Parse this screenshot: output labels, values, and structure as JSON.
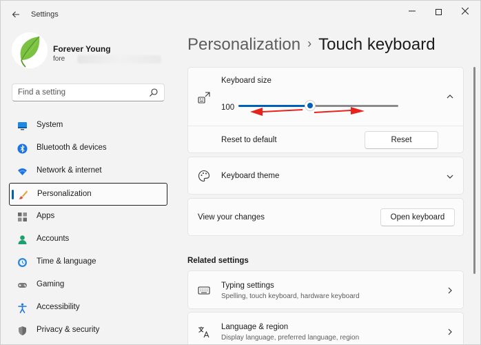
{
  "window": {
    "title": "Settings"
  },
  "profile": {
    "name": "Forever Young",
    "email_visible": "fore"
  },
  "search": {
    "placeholder": "Find a setting"
  },
  "nav": {
    "items": [
      {
        "label": "System",
        "icon": "system-icon",
        "color": "#0067c0"
      },
      {
        "label": "Bluetooth & devices",
        "icon": "bluetooth-icon",
        "color": "#0067c0"
      },
      {
        "label": "Network & internet",
        "icon": "network-icon",
        "color": "#0067c0"
      },
      {
        "label": "Personalization",
        "icon": "brush-icon",
        "color": "#e07a2c",
        "active": true
      },
      {
        "label": "Apps",
        "icon": "apps-icon",
        "color": "#555555"
      },
      {
        "label": "Accounts",
        "icon": "accounts-icon",
        "color": "#1f9e6e"
      },
      {
        "label": "Time & language",
        "icon": "globe-clock-icon",
        "color": "#0067c0"
      },
      {
        "label": "Gaming",
        "icon": "gamepad-icon",
        "color": "#6b6b6b"
      },
      {
        "label": "Accessibility",
        "icon": "accessibility-icon",
        "color": "#0067c0"
      },
      {
        "label": "Privacy & security",
        "icon": "shield-icon",
        "color": "#6b6b6b"
      }
    ]
  },
  "breadcrumb": {
    "parent": "Personalization",
    "separator": "›",
    "current": "Touch keyboard"
  },
  "keyboard_size": {
    "title": "Keyboard size",
    "value": "100",
    "slider_fraction": 0.45,
    "reset_label": "Reset to default",
    "reset_button": "Reset"
  },
  "keyboard_theme": {
    "title": "Keyboard theme"
  },
  "view_changes": {
    "label": "View your changes",
    "button": "Open keyboard"
  },
  "related": {
    "title": "Related settings",
    "items": [
      {
        "title": "Typing settings",
        "subtitle": "Spelling, touch keyboard, hardware keyboard"
      },
      {
        "title": "Language & region",
        "subtitle": "Display language, preferred language, region"
      }
    ]
  },
  "colors": {
    "accent": "#005fb8",
    "annotation_arrow": "#e8231b"
  }
}
